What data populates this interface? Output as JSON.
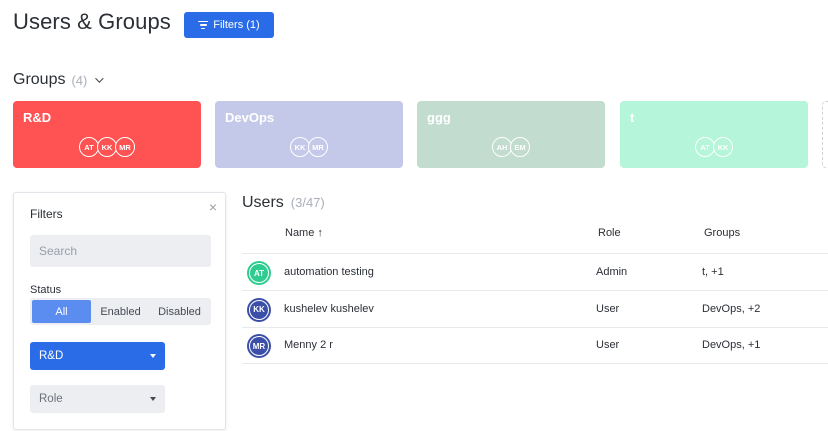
{
  "header": {
    "title": "Users & Groups",
    "filters_button": "Filters (1)"
  },
  "groups": {
    "heading": "Groups",
    "count": "(4)",
    "cards": [
      {
        "name": "R&D",
        "color": "#ff5252",
        "members": [
          {
            "initials": "AT",
            "color": "#ff5252"
          },
          {
            "initials": "KK",
            "color": "#ff5252"
          },
          {
            "initials": "MR",
            "color": "#ff5252"
          }
        ]
      },
      {
        "name": "DevOps",
        "color": "#c5c9e9",
        "members": [
          {
            "initials": "KK",
            "color": "#c5c9e9"
          },
          {
            "initials": "MR",
            "color": "#c5c9e9"
          }
        ]
      },
      {
        "name": "ggg",
        "color": "#c2dcd0",
        "members": [
          {
            "initials": "AH",
            "color": "#c2dcd0"
          },
          {
            "initials": "EM",
            "color": "#c2dcd0"
          }
        ]
      },
      {
        "name": "t",
        "color": "#b5f5da",
        "members": [
          {
            "initials": "AT",
            "color": "#b5f5da"
          },
          {
            "initials": "KK",
            "color": "#b5f5da"
          }
        ]
      }
    ]
  },
  "filters": {
    "title": "Filters",
    "close_icon": "×",
    "search_placeholder": "Search",
    "status_label": "Status",
    "status_options": [
      "All",
      "Enabled",
      "Disabled"
    ],
    "status_selected": "All",
    "group_value": "R&D",
    "role_placeholder": "Role"
  },
  "users": {
    "heading": "Users",
    "count": "(3/47)",
    "columns": {
      "name": "Name ↑",
      "role": "Role",
      "groups": "Groups"
    },
    "rows": [
      {
        "initials": "AT",
        "avatar_color": "#2ecc8f",
        "name": "automation testing",
        "role": "Admin",
        "groups": "t, +1"
      },
      {
        "initials": "KK",
        "avatar_color": "#3b4fa8",
        "name": "kushelev kushelev",
        "role": "User",
        "groups": "DevOps, +2"
      },
      {
        "initials": "MR",
        "avatar_color": "#3b4fa8",
        "name": "Menny 2 r",
        "role": "User",
        "groups": "DevOps, +1"
      }
    ]
  }
}
